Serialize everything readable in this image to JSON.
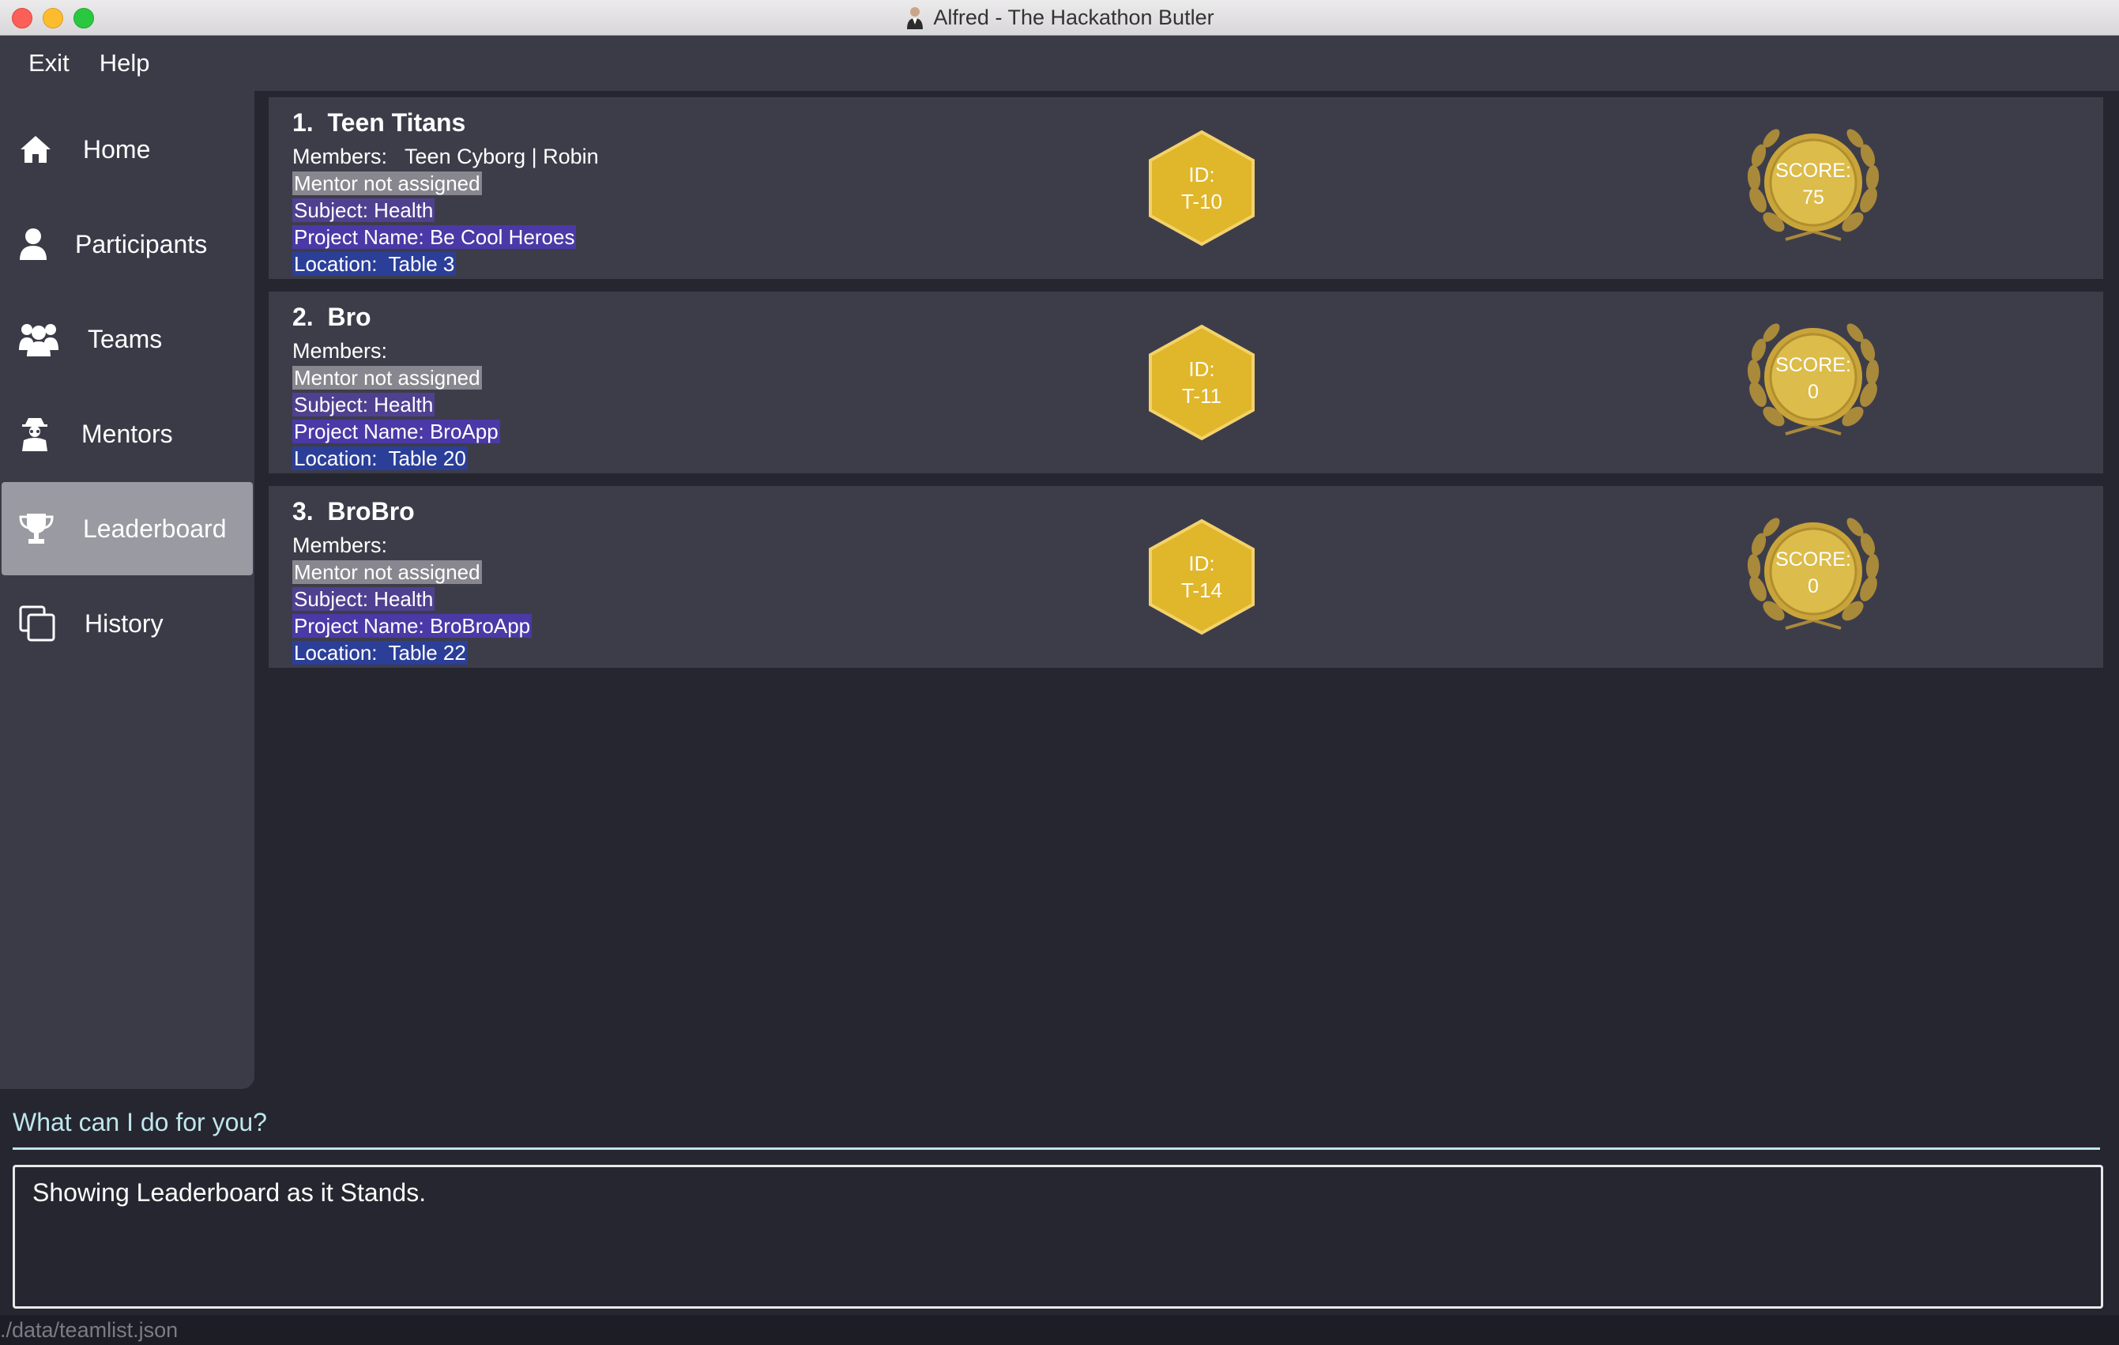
{
  "window": {
    "title": "Alfred - The Hackathon Butler"
  },
  "menu": {
    "items": [
      "Exit",
      "Help"
    ]
  },
  "sidebar": {
    "items": [
      {
        "label": "Home",
        "icon": "home-icon",
        "active": false
      },
      {
        "label": "Participants",
        "icon": "person-icon",
        "active": false
      },
      {
        "label": "Teams",
        "icon": "users-icon",
        "active": false
      },
      {
        "label": "Mentors",
        "icon": "mentor-icon",
        "active": false
      },
      {
        "label": "Leaderboard",
        "icon": "trophy-icon",
        "active": true
      },
      {
        "label": "History",
        "icon": "copy-icon",
        "active": false
      }
    ]
  },
  "teams": [
    {
      "name": "1.  Teen Titans",
      "members": "Members:   Teen Cyborg | Robin",
      "mentor": "Mentor not assigned",
      "subject": "Subject: Health",
      "project": "Project Name: Be Cool Heroes",
      "location": "Location:  Table 3",
      "id_label": "ID:",
      "id": "T-10",
      "score_label": "SCORE:",
      "score": "75"
    },
    {
      "name": "2.  Bro",
      "members": "Members:",
      "mentor": "Mentor not assigned",
      "subject": "Subject: Health",
      "project": "Project Name: BroApp",
      "location": "Location:  Table 20",
      "id_label": "ID:",
      "id": "T-11",
      "score_label": "SCORE:",
      "score": "0"
    },
    {
      "name": "3.  BroBro",
      "members": "Members:",
      "mentor": "Mentor not assigned",
      "subject": "Subject: Health",
      "project": "Project Name: BroBroApp",
      "location": "Location:  Table 22",
      "id_label": "ID:",
      "id": "T-14",
      "score_label": "SCORE:",
      "score": "0"
    }
  ],
  "command": {
    "placeholder": "What can I do for you?",
    "value": ""
  },
  "result": {
    "text": "Showing Leaderboard as it Stands."
  },
  "status": {
    "path": "./data/teamlist.json"
  },
  "colors": {
    "accent": "#e3b92b",
    "background": "#262630",
    "panel": "#3b3b48"
  }
}
